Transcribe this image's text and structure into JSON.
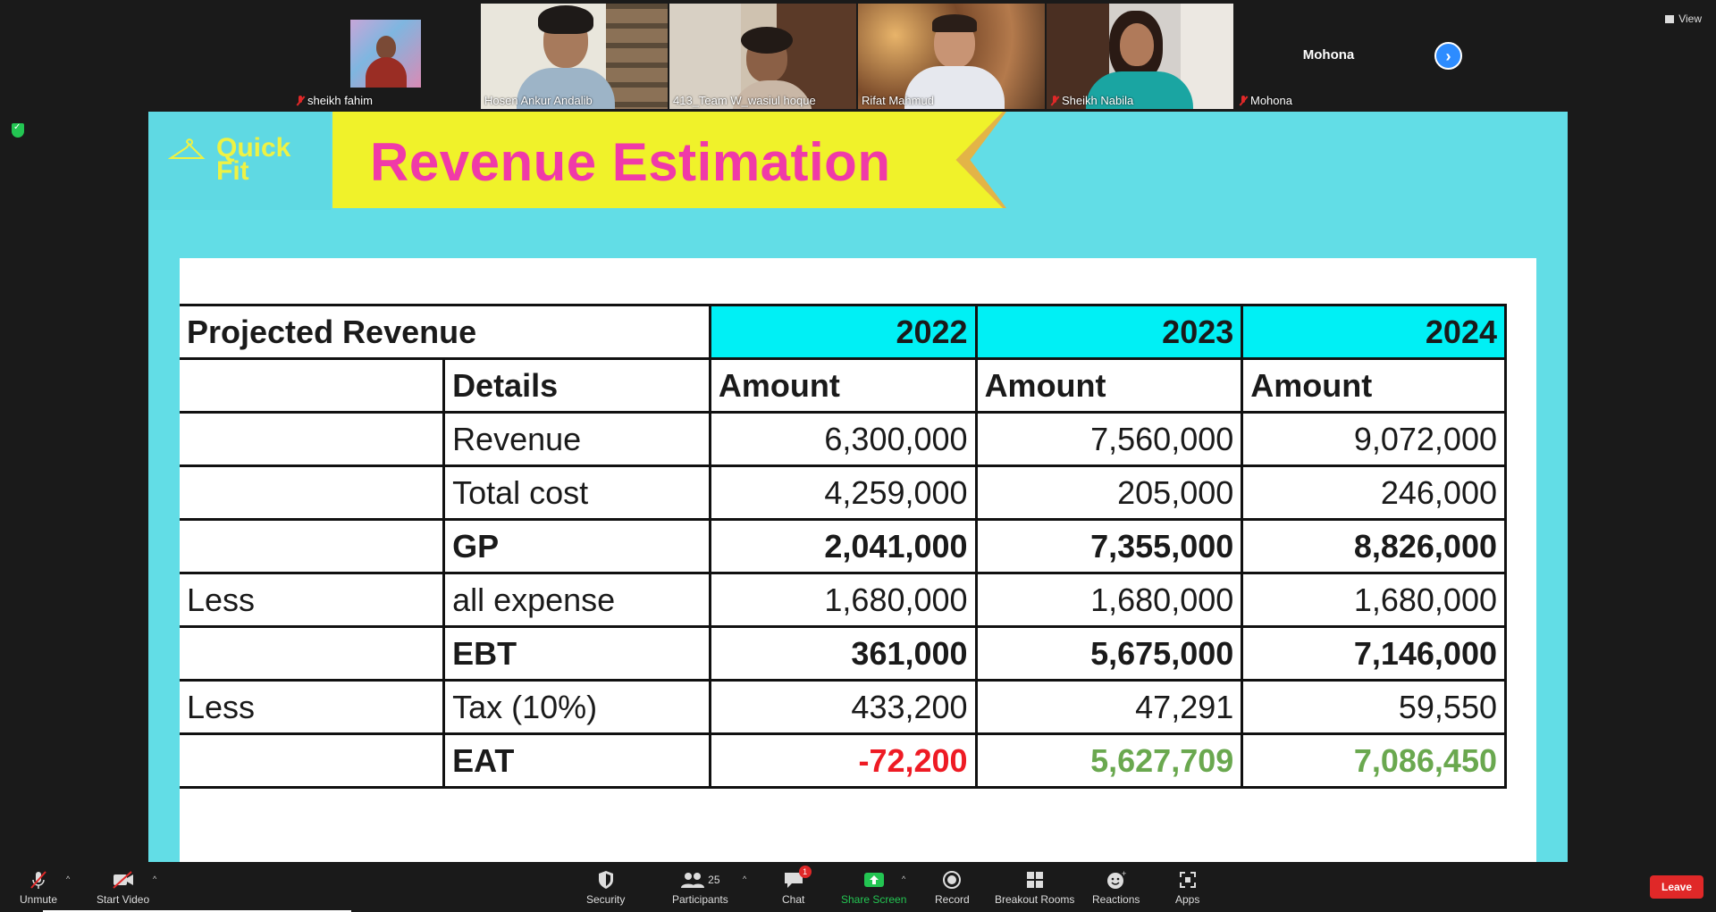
{
  "participants": [
    {
      "name": "sheikh fahim",
      "muted": true
    },
    {
      "name": "Hosen Ankur Andalib",
      "muted": false
    },
    {
      "name": "413_Team W_wasiul hoque",
      "muted": false
    },
    {
      "name": "Rifat Mahmud",
      "muted": false
    },
    {
      "name": "Sheikh Nabila",
      "muted": true
    },
    {
      "name": "Mohona",
      "muted": true,
      "video_off": true
    }
  ],
  "view_label": "View",
  "slide": {
    "logo_line1": "Quick",
    "logo_line2": "Fit",
    "title": "Revenue Estimation",
    "table": {
      "header": [
        "Projected Revenue",
        "2022",
        "2023",
        "2024"
      ],
      "subheader": [
        "",
        "Details",
        "Amount",
        "Amount",
        "Amount"
      ],
      "rows": [
        {
          "prefix": "",
          "detail": "Revenue",
          "v2022": "6,300,000",
          "v2023": "7,560,000",
          "v2024": "9,072,000",
          "bold": false
        },
        {
          "prefix": "",
          "detail": "Total cost",
          "v2022": "4,259,000",
          "v2023": "205,000",
          "v2024": "246,000",
          "bold": false
        },
        {
          "prefix": "",
          "detail": "GP",
          "v2022": "2,041,000",
          "v2023": "7,355,000",
          "v2024": "8,826,000",
          "bold": true
        },
        {
          "prefix": "Less",
          "detail": "all expense",
          "v2022": "1,680,000",
          "v2023": "1,680,000",
          "v2024": "1,680,000",
          "bold": false
        },
        {
          "prefix": "",
          "detail": "EBT",
          "v2022": "361,000",
          "v2023": "5,675,000",
          "v2024": "7,146,000",
          "bold": true
        },
        {
          "prefix": "Less",
          "detail": "Tax (10%)",
          "v2022": "433,200",
          "v2023": "47,291",
          "v2024": "59,550",
          "bold": false
        },
        {
          "prefix": "",
          "detail": "EAT",
          "v2022": "-72,200",
          "v2023": "5,627,709",
          "v2024": "7,086,450",
          "bold": true
        }
      ]
    }
  },
  "toolbar": {
    "unmute": "Unmute",
    "start_video": "Start Video",
    "security": "Security",
    "participants": "Participants",
    "participants_count": "25",
    "chat": "Chat",
    "chat_badge": "1",
    "share_screen": "Share Screen",
    "record": "Record",
    "breakout_rooms": "Breakout Rooms",
    "reactions": "Reactions",
    "apps": "Apps",
    "leave": "Leave"
  },
  "colors": {
    "slide_bg": "#62dde6",
    "banner": "#f0f22a",
    "title": "#f03aa8",
    "year_header": "#00f0f5",
    "negative": "#ee1b24",
    "positive": "#6aa84f",
    "share_green": "#23c552",
    "leave_red": "#e02828"
  }
}
